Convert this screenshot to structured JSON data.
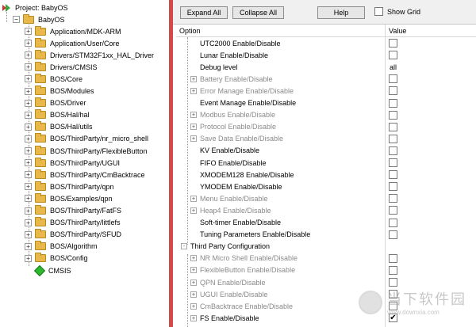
{
  "tree": {
    "project_label": "Project: BabyOS",
    "root_label": "BabyOS",
    "groups": [
      "Application/MDK-ARM",
      "Application/User/Core",
      "Drivers/STM32F1xx_HAL_Driver",
      "Drivers/CMSIS",
      "BOS/Core",
      "BOS/Modules",
      "BOS/Driver",
      "BOS/Hal/hal",
      "BOS/Hal/utils",
      "BOS/ThirdParty/nr_micro_shell",
      "BOS/ThirdParty/FlexibleButton",
      "BOS/ThirdParty/UGUI",
      "BOS/ThirdParty/CmBacktrace",
      "BOS/ThirdParty/qpn",
      "BOS/Examples/qpn",
      "BOS/ThirdParty/FatFS",
      "BOS/ThirdParty/littlefs",
      "BOS/ThirdParty/SFUD",
      "BOS/Algorithm",
      "BOS/Config"
    ],
    "cmsis_label": "CMSIS"
  },
  "toolbar": {
    "expand_all": "Expand All",
    "collapse_all": "Collapse All",
    "help": "Help",
    "show_grid": "Show Grid"
  },
  "grid": {
    "col_option": "Option",
    "col_value": "Value",
    "rows": [
      {
        "label": "UTC2000 Enable/Disable",
        "dim": false,
        "expander": false,
        "indent": 1,
        "value": "checkbox",
        "checked": false
      },
      {
        "label": "Lunar Enable/Disable",
        "dim": false,
        "expander": false,
        "indent": 1,
        "value": "checkbox",
        "checked": false
      },
      {
        "label": "Debug level",
        "dim": false,
        "expander": false,
        "indent": 1,
        "value": "text",
        "text": "all"
      },
      {
        "label": "Battery Enable/Disable",
        "dim": true,
        "expander": true,
        "indent": 1,
        "value": "checkbox",
        "checked": false
      },
      {
        "label": "Error Manage Enable/Disable",
        "dim": true,
        "expander": true,
        "indent": 1,
        "value": "checkbox",
        "checked": false
      },
      {
        "label": "Event Manage Enable/Disable",
        "dim": false,
        "expander": false,
        "indent": 1,
        "value": "checkbox",
        "checked": false
      },
      {
        "label": "Modbus Enable/Disable",
        "dim": true,
        "expander": true,
        "indent": 1,
        "value": "checkbox",
        "checked": false
      },
      {
        "label": "Protocol Enable/Disable",
        "dim": true,
        "expander": true,
        "indent": 1,
        "value": "checkbox",
        "checked": false
      },
      {
        "label": "Save Data Enable/Disable",
        "dim": true,
        "expander": true,
        "indent": 1,
        "value": "checkbox",
        "checked": false
      },
      {
        "label": "KV Enable/Disable",
        "dim": false,
        "expander": false,
        "indent": 1,
        "value": "checkbox",
        "checked": false
      },
      {
        "label": "FIFO Enable/Disable",
        "dim": false,
        "expander": false,
        "indent": 1,
        "value": "checkbox",
        "checked": false
      },
      {
        "label": "XMODEM128 Enable/Disable",
        "dim": false,
        "expander": false,
        "indent": 1,
        "value": "checkbox",
        "checked": false
      },
      {
        "label": "YMODEM Enable/Disable",
        "dim": false,
        "expander": false,
        "indent": 1,
        "value": "checkbox",
        "checked": false
      },
      {
        "label": "Menu Enable/Disable",
        "dim": true,
        "expander": true,
        "indent": 1,
        "value": "checkbox",
        "checked": false
      },
      {
        "label": "Heap4 Enable/Disable",
        "dim": true,
        "expander": true,
        "indent": 1,
        "value": "checkbox",
        "checked": false
      },
      {
        "label": "Soft-timer Enable/Disable",
        "dim": false,
        "expander": false,
        "indent": 1,
        "value": "checkbox",
        "checked": false
      },
      {
        "label": "Tuning Parameters Enable/Disable",
        "dim": false,
        "expander": false,
        "indent": 1,
        "value": "checkbox",
        "checked": false
      },
      {
        "label": "Third Party Configuration",
        "dim": false,
        "expander": true,
        "expander_sign": "-",
        "indent": 0,
        "value": "none"
      },
      {
        "label": "NR Micro Shell Enable/Disable",
        "dim": true,
        "expander": true,
        "indent": 1,
        "value": "checkbox",
        "checked": false
      },
      {
        "label": "FlexibleButton Enable/Disable",
        "dim": true,
        "expander": true,
        "indent": 1,
        "value": "checkbox",
        "checked": false
      },
      {
        "label": "QPN Enable/Disable",
        "dim": true,
        "expander": true,
        "indent": 1,
        "value": "checkbox",
        "checked": false
      },
      {
        "label": "UGUI Enable/Disable",
        "dim": true,
        "expander": true,
        "indent": 1,
        "value": "checkbox",
        "checked": false
      },
      {
        "label": "CmBacktrace Enable/Disable",
        "dim": true,
        "expander": true,
        "indent": 1,
        "value": "checkbox",
        "checked": false
      },
      {
        "label": "FS Enable/Disable",
        "dim": false,
        "expander": true,
        "indent": 1,
        "value": "checkbox",
        "checked": true
      }
    ]
  },
  "watermark": {
    "brand_cn": "当下软件园",
    "url": "www.downxia.com"
  }
}
